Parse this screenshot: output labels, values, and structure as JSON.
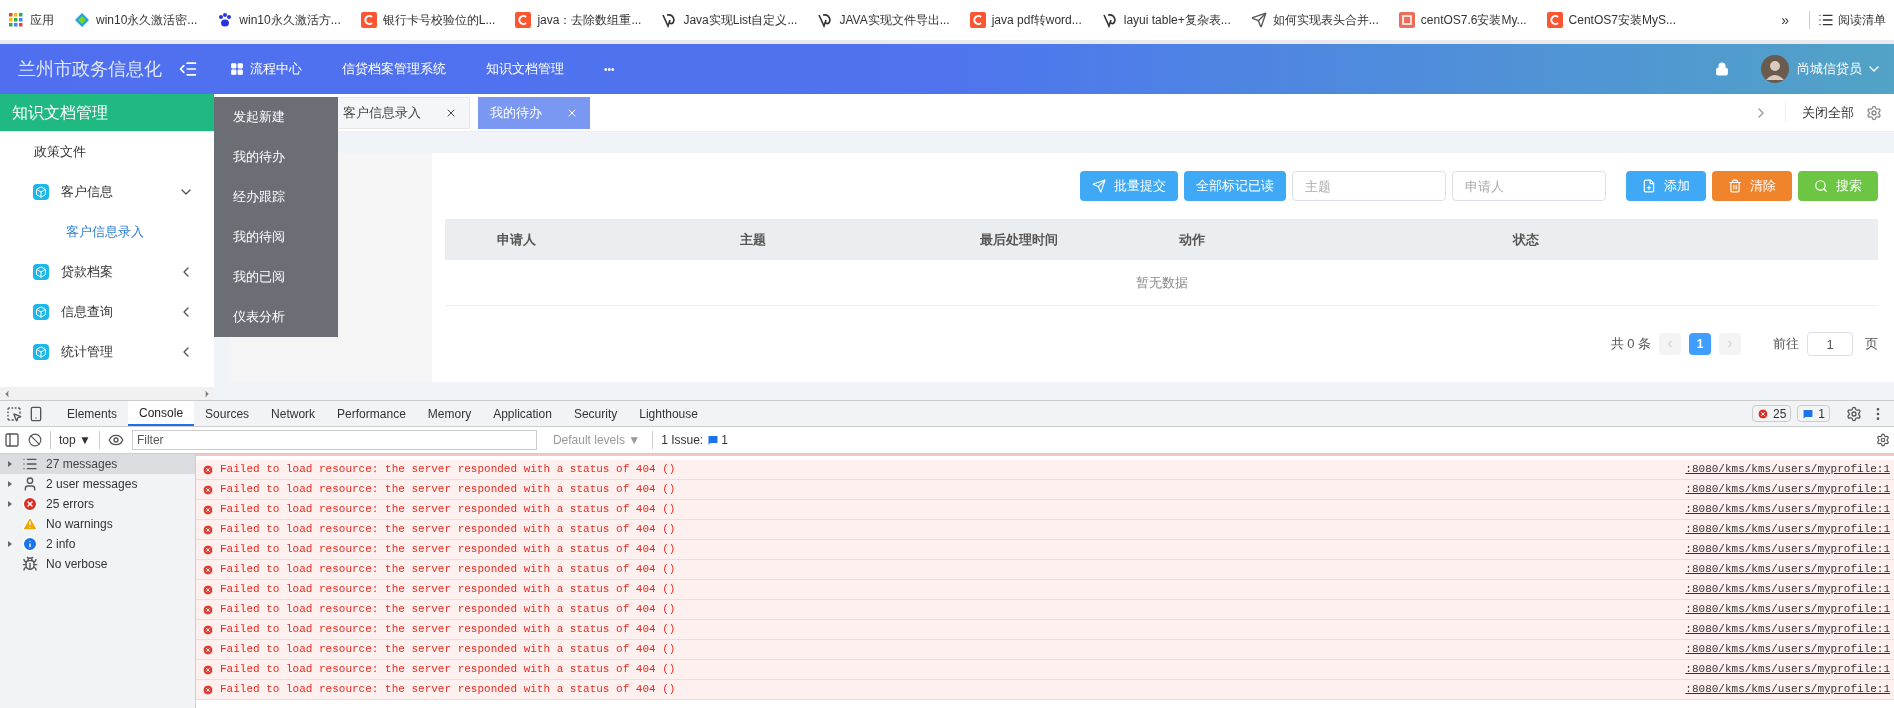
{
  "bookmarks": [
    {
      "label": "应用",
      "kind": "apps"
    },
    {
      "label": "win10永久激活密...",
      "kind": "diamond"
    },
    {
      "label": "win10永久激活方...",
      "kind": "paw"
    },
    {
      "label": "银行卡号校验位的L...",
      "kind": "csdn"
    },
    {
      "label": "java：去除数组重...",
      "kind": "csdn"
    },
    {
      "label": "Java实现List自定义...",
      "kind": "swirl"
    },
    {
      "label": "JAVA实现文件导出...",
      "kind": "swirl"
    },
    {
      "label": "java pdf转word...",
      "kind": "csdn"
    },
    {
      "label": "layui table+复杂表...",
      "kind": "swirl"
    },
    {
      "label": "如何实现表头合并...",
      "kind": "send"
    },
    {
      "label": "centOS7.6安装My...",
      "kind": "jian"
    },
    {
      "label": "CentOS7安装MyS...",
      "kind": "csdn"
    }
  ],
  "bookmarks_more": "»",
  "reading_list": "阅读清单",
  "header": {
    "logo": "兰州市政务信息化",
    "nav": [
      {
        "label": "流程中心",
        "kind": "grid"
      },
      {
        "label": "信贷档案管理系统",
        "kind": "plain"
      },
      {
        "label": "知识文档管理",
        "kind": "plain"
      }
    ],
    "more": "•••",
    "user": "尚城信贷员"
  },
  "sidebar": {
    "title": "知识文档管理",
    "items": [
      {
        "label": "政策文件",
        "kind": "plain"
      },
      {
        "label": "客户信息",
        "kind": "group",
        "expanded": true,
        "children": [
          {
            "label": "客户信息录入",
            "selected": true
          }
        ]
      },
      {
        "label": "贷款档案",
        "kind": "group",
        "expanded": false
      },
      {
        "label": "信息查询",
        "kind": "group",
        "expanded": false
      },
      {
        "label": "统计管理",
        "kind": "group",
        "expanded": false
      }
    ]
  },
  "dropdown": [
    "发起新建",
    "我的待办",
    "经办跟踪",
    "我的待阅",
    "我的已阅",
    "仪表分析"
  ],
  "tabs": [
    {
      "label": "客户信息录入",
      "selected": false
    },
    {
      "label": "我的待办",
      "selected": true
    }
  ],
  "close_all": "关闭全部",
  "toolbar": {
    "buttons": [
      {
        "label": "批量提交",
        "kind": "send",
        "color": "#3fa9f5"
      },
      {
        "label": "全部标记已读",
        "kind": "none",
        "color": "#3fa9f5"
      }
    ],
    "fields": [
      {
        "placeholder": "主题"
      },
      {
        "placeholder": "申请人"
      }
    ],
    "actions": [
      {
        "label": "添加",
        "kind": "file",
        "color": "#3fa9f5"
      },
      {
        "label": "清除",
        "kind": "trash",
        "color": "#f0842c"
      },
      {
        "label": "搜索",
        "kind": "search",
        "color": "#6cc644"
      }
    ]
  },
  "table": {
    "columns": [
      "申请人",
      "主题",
      "最后处理时间",
      "动作",
      "状态"
    ],
    "empty": "暂无数据"
  },
  "pagination": {
    "total": "共 0 条",
    "page": "1",
    "goto": "前往",
    "goto_value": "1",
    "unit": "页"
  },
  "devtools": {
    "tabs": [
      {
        "label": "Elements",
        "selected": false
      },
      {
        "label": "Console",
        "selected": true
      },
      {
        "label": "Sources",
        "selected": false
      },
      {
        "label": "Network",
        "selected": false
      },
      {
        "label": "Performance",
        "selected": false
      },
      {
        "label": "Memory",
        "selected": false
      },
      {
        "label": "Application",
        "selected": false
      },
      {
        "label": "Security",
        "selected": false
      },
      {
        "label": "Lighthouse",
        "selected": false
      }
    ],
    "error_count": "25",
    "message_count": "1",
    "context": "top ▼",
    "filter_placeholder": "Filter",
    "levels": "Default levels ▼",
    "issues_label": "1 Issue:",
    "issues_count": "1",
    "sidebar": [
      {
        "label": "27 messages",
        "kind": "list",
        "selected": true,
        "expandable": true
      },
      {
        "label": "2 user messages",
        "kind": "user",
        "selected": false,
        "expandable": true
      },
      {
        "label": "25 errors",
        "kind": "error",
        "selected": false,
        "expandable": true
      },
      {
        "label": "No warnings",
        "kind": "warning",
        "selected": false,
        "expandable": false
      },
      {
        "label": "2 info",
        "kind": "info",
        "selected": false,
        "expandable": true
      },
      {
        "label": "No verbose",
        "kind": "verbose",
        "selected": false,
        "expandable": false
      }
    ],
    "messages": [
      {
        "text": "Failed to load resource: the server responded with a status of 404 ()",
        "source": ":8080/kms/kms/users/myprofile:1"
      },
      {
        "text": "Failed to load resource: the server responded with a status of 404 ()",
        "source": ":8080/kms/kms/users/myprofile:1"
      },
      {
        "text": "Failed to load resource: the server responded with a status of 404 ()",
        "source": ":8080/kms/kms/users/myprofile:1"
      },
      {
        "text": "Failed to load resource: the server responded with a status of 404 ()",
        "source": ":8080/kms/kms/users/myprofile:1"
      },
      {
        "text": "Failed to load resource: the server responded with a status of 404 ()",
        "source": ":8080/kms/kms/users/myprofile:1"
      },
      {
        "text": "Failed to load resource: the server responded with a status of 404 ()",
        "source": ":8080/kms/kms/users/myprofile:1"
      },
      {
        "text": "Failed to load resource: the server responded with a status of 404 ()",
        "source": ":8080/kms/kms/users/myprofile:1"
      },
      {
        "text": "Failed to load resource: the server responded with a status of 404 ()",
        "source": ":8080/kms/kms/users/myprofile:1"
      },
      {
        "text": "Failed to load resource: the server responded with a status of 404 ()",
        "source": ":8080/kms/kms/users/myprofile:1"
      },
      {
        "text": "Failed to load resource: the server responded with a status of 404 ()",
        "source": ":8080/kms/kms/users/myprofile:1"
      },
      {
        "text": "Failed to load resource: the server responded with a status of 404 ()",
        "source": ":8080/kms/kms/users/myprofile:1"
      },
      {
        "text": "Failed to load resource: the server responded with a status of 404 ()",
        "source": ":8080/kms/kms/users/myprofile:1"
      }
    ]
  }
}
